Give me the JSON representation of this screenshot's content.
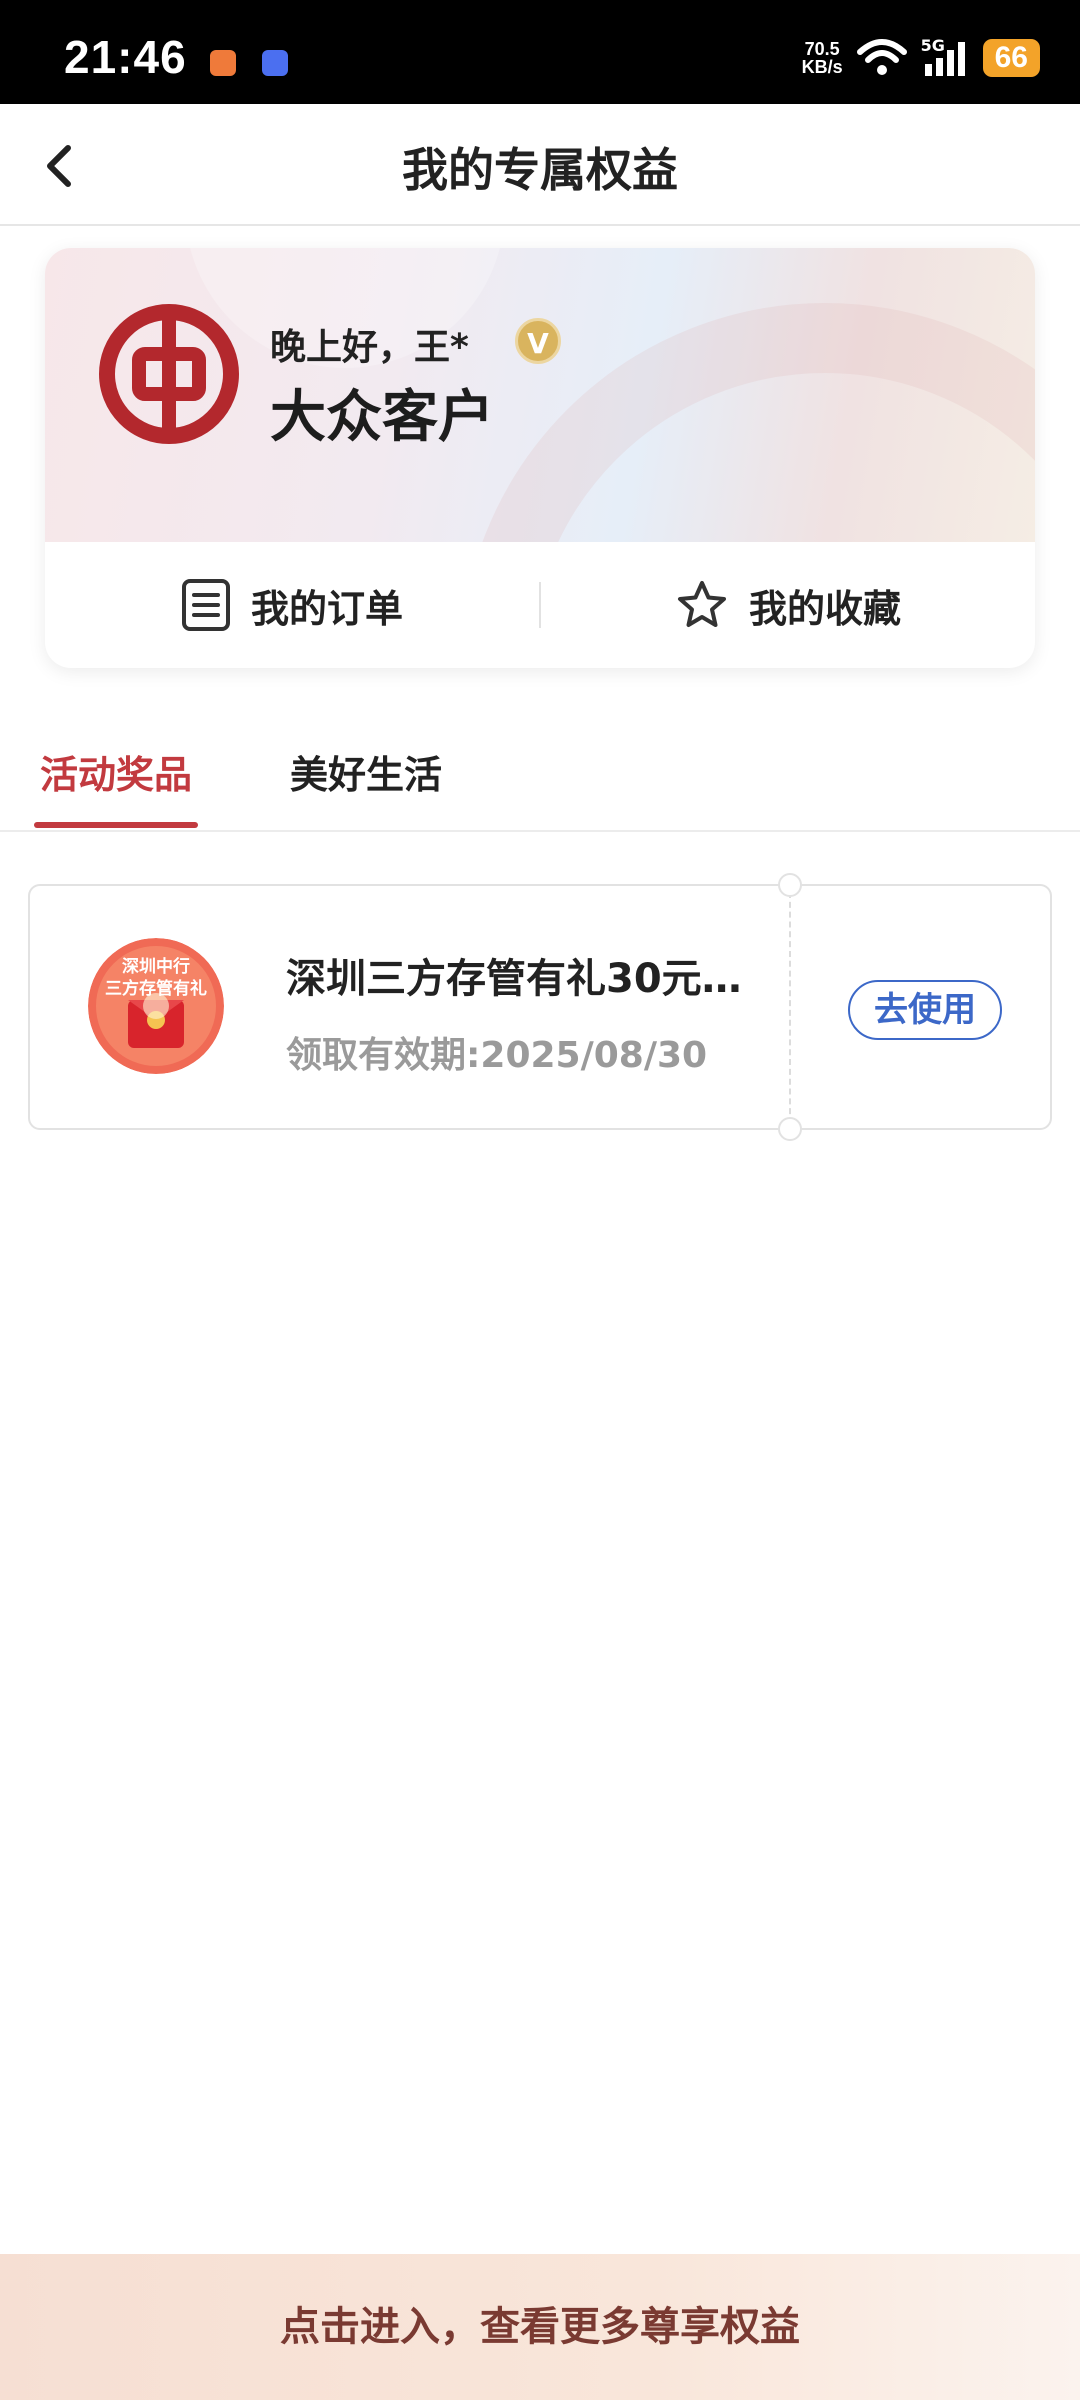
{
  "status_bar": {
    "time": "21:46",
    "net_speed_value": "70.5",
    "net_speed_unit": "KB/s",
    "network": "5G",
    "battery": "66"
  },
  "header": {
    "title": "我的专属权益"
  },
  "profile_card": {
    "greeting": "晚上好，王*",
    "vip_badge": "V",
    "customer_level": "大众客户",
    "actions": [
      {
        "label": "我的订单",
        "icon": "order-list-icon"
      },
      {
        "label": "我的收藏",
        "icon": "star-icon"
      }
    ]
  },
  "tabs": [
    {
      "label": "活动奖品",
      "active": true
    },
    {
      "label": "美好生活",
      "active": false
    }
  ],
  "coupons": [
    {
      "image_lines": [
        "深圳中行",
        "三方存管有礼"
      ],
      "title": "深圳三方存管有礼30元…",
      "expiry": "领取有效期:2025/08/30",
      "action_label": "去使用"
    }
  ],
  "bottom_banner": {
    "label": "点击进入，查看更多尊享权益"
  },
  "colors": {
    "accent_red": "#c23a3f",
    "action_blue": "#3c68c8",
    "battery": "#f3a329"
  }
}
